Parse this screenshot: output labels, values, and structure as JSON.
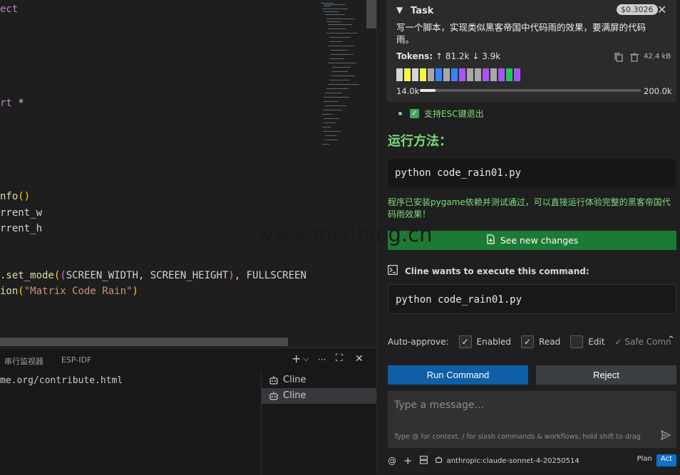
{
  "editor": {
    "lines": [
      {
        "parts": [
          {
            "t": "ect",
            "c": "kw"
          }
        ]
      },
      {
        "parts": [
          {
            "t": "rt",
            "c": "kw"
          },
          {
            "t": " *",
            "c": "var"
          }
        ]
      },
      {
        "parts": [
          {
            "t": "nfo",
            "c": "fn"
          },
          {
            "t": "()",
            "c": "paren"
          }
        ]
      },
      {
        "parts": [
          {
            "t": "rrent_w",
            "c": "var"
          }
        ]
      },
      {
        "parts": [
          {
            "t": "rrent_h",
            "c": "var"
          }
        ]
      },
      {
        "parts": [
          {
            "t": ".set_mode",
            "c": "fn"
          },
          {
            "t": "(",
            "c": "paren"
          },
          {
            "t": "(",
            "c": "paren2"
          },
          {
            "t": "SCREEN_WIDTH, SCREEN_HEIGHT",
            "c": "var"
          },
          {
            "t": ")",
            "c": "paren2"
          },
          {
            "t": ", FULLSCREEN",
            "c": "var"
          }
        ]
      },
      {
        "parts": [
          {
            "t": "ion",
            "c": "fn"
          },
          {
            "t": "(",
            "c": "paren"
          },
          {
            "t": "\"Matrix Code Rain\"",
            "c": "str"
          },
          {
            "t": ")",
            "c": "paren"
          }
        ]
      }
    ]
  },
  "panel": {
    "tabs": [
      "串行监视器",
      "ESP-IDF"
    ],
    "actions": {
      "add": "+",
      "dropdown": "⌵",
      "more": "···",
      "maximize": "⛶",
      "close": "✕"
    },
    "output_line": "me.org/contribute.html",
    "terminals": [
      "Cline",
      "Cline"
    ]
  },
  "cline": {
    "task": {
      "title": "Task",
      "cost": "$0.3026",
      "text": "写一个脚本，实现类似黑客帝国中代码雨的效果，要满屏的代码雨。",
      "tokens_label": "Tokens:",
      "tokens_in": "↑ 81.2k",
      "tokens_out": "↓ 3.9k",
      "size": "42.4 kB",
      "block_colors": [
        "#d6d6d6",
        "#f5f542",
        "#d6d6d6",
        "#f5f542",
        "#a8a8a8",
        "#3b82f6",
        "#a8a8a8",
        "#3b82f6",
        "#a855f7",
        "#a8a8a8",
        "#a8a8a8",
        "#a855f7",
        "#a8a8a8",
        "#a855f7",
        "#22c55e",
        "#a855f7"
      ],
      "context_used": "14.0k",
      "context_max": "200.0k",
      "context_fraction": 0.07
    },
    "check_item": "支持ESC键退出",
    "run_heading": "运行方法：",
    "code1": "python code_rain01.py",
    "success_text": "程序已安装pygame依赖并测试通过，可以直接运行体验完整的黑客帝国代码雨效果！",
    "see_changes": "See new changes",
    "cmd_header": "Cline wants to execute this command:",
    "code2": "python code_rain01.py",
    "auto_approve": {
      "label": "Auto-approve:",
      "enabled": "Enabled",
      "read": "Read",
      "edit": "Edit",
      "safe": "✓ Safe Comn"
    },
    "run_command": "Run Command",
    "reject": "Reject",
    "message_placeholder": "Type a message...",
    "message_hint": "Type @ for context, / for slash commands & workflows, hold shift to drag in fi...",
    "bottom": {
      "at": "@",
      "plus": "+",
      "model": "anthropic:claude-sonnet-4-20250514",
      "plan": "Plan",
      "act": "Act"
    }
  },
  "watermark": "www.mcublog.cn"
}
